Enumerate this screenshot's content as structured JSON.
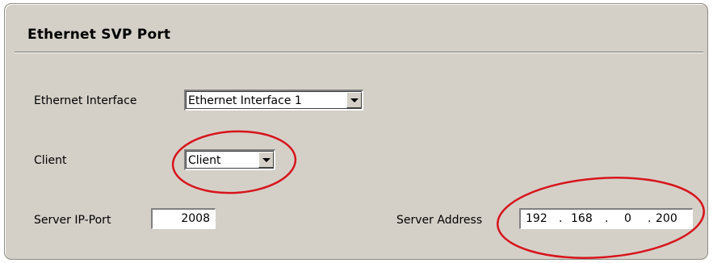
{
  "panel": {
    "title": "Ethernet SVP Port"
  },
  "ethernet_interface": {
    "label": "Ethernet Interface",
    "selected": "Ethernet Interface 1"
  },
  "client": {
    "label": "Client",
    "selected": "Client"
  },
  "server_port": {
    "label": "Server IP-Port",
    "value": "2008"
  },
  "server_address": {
    "label": "Server Address",
    "octets": [
      "192",
      "168",
      "0",
      "200"
    ]
  },
  "colors": {
    "panel_bg": "#d4d0c8",
    "annotation_ring": "#d8141c"
  },
  "icons": {
    "dropdown": "chevron-down-icon"
  }
}
